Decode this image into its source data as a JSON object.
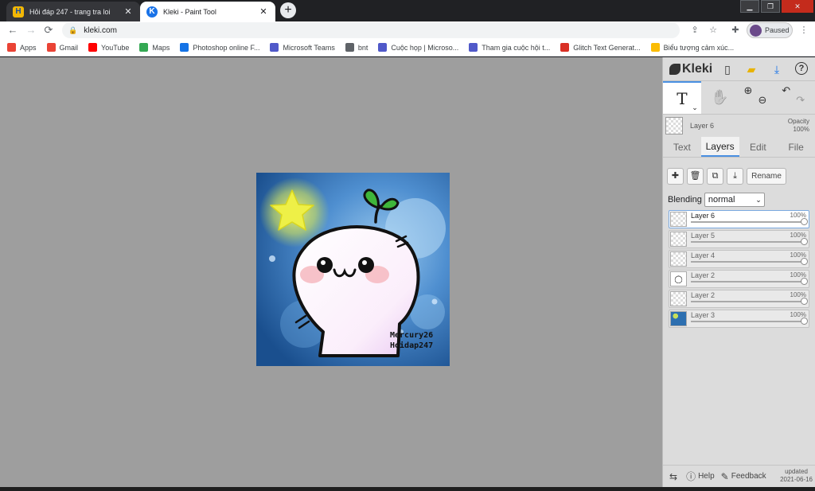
{
  "browser": {
    "tabs": [
      {
        "title": "Hỏi đáp 247 - trang tra loi",
        "favicon": "H",
        "favicon_color": "#f2b705"
      },
      {
        "title": "Kleki - Paint Tool",
        "favicon": "K",
        "favicon_color": "#1a73e8"
      }
    ],
    "address": "kleki.com",
    "profile_status": "Paused",
    "bookmarks": [
      {
        "label": "Apps",
        "icon": "apps-grid-icon",
        "color": "#ea4335"
      },
      {
        "label": "Gmail",
        "icon": "gmail-icon",
        "color": "#ea4335"
      },
      {
        "label": "YouTube",
        "icon": "youtube-icon",
        "color": "#ff0000"
      },
      {
        "label": "Maps",
        "icon": "maps-icon",
        "color": "#34a853"
      },
      {
        "label": "Photoshop online F...",
        "icon": "photoshop-icon",
        "color": "#1473e6"
      },
      {
        "label": "Microsoft Teams",
        "icon": "teams-icon",
        "color": "#5059c9"
      },
      {
        "label": "bnt",
        "icon": "globe-icon",
        "color": "#5f6368"
      },
      {
        "label": "Cuộc họp | Microso...",
        "icon": "teams-icon",
        "color": "#5059c9"
      },
      {
        "label": "Tham gia cuộc hội t...",
        "icon": "teams-icon",
        "color": "#5059c9"
      },
      {
        "label": "Glitch Text Generat...",
        "icon": "glitch-icon",
        "color": "#d93025"
      },
      {
        "label": "Biểu tượng cảm xúc...",
        "icon": "emoji-icon",
        "color": "#fbbc04"
      }
    ]
  },
  "app": {
    "name": "Kleki",
    "tools": {
      "text": "T",
      "hand": "✋"
    },
    "current_layer": {
      "name": "Layer 6",
      "opacity_label": "Opacity",
      "opacity_value": "100%"
    },
    "panel_tabs": [
      "Text",
      "Layers",
      "Edit",
      "File"
    ],
    "selected_tab": "Layers",
    "layer_buttons": {
      "rename": "Rename"
    },
    "blending": {
      "label": "Blending",
      "value": "normal"
    },
    "layers": [
      {
        "name": "Layer 6",
        "opacity": "100%",
        "level": 1.0,
        "active": true,
        "thumb": "empty"
      },
      {
        "name": "Layer 5",
        "opacity": "100%",
        "level": 1.0,
        "active": false,
        "thumb": "empty"
      },
      {
        "name": "Layer 4",
        "opacity": "100%",
        "level": 1.0,
        "active": false,
        "thumb": "empty"
      },
      {
        "name": "Layer 2",
        "opacity": "100%",
        "level": 1.0,
        "active": false,
        "thumb": "face"
      },
      {
        "name": "Layer 2",
        "opacity": "100%",
        "level": 1.0,
        "active": false,
        "thumb": "empty"
      },
      {
        "name": "Layer 3",
        "opacity": "100%",
        "level": 1.0,
        "active": false,
        "thumb": "bg"
      }
    ],
    "footer": {
      "help": "Help",
      "feedback": "Feedback",
      "updated_label": "updated",
      "updated_date": "2021-06-16"
    }
  },
  "artwork": {
    "watermark_line1": "Mercury26",
    "watermark_line2": "Hoidap247",
    "colors": {
      "sky_dark": "#1f5a9c",
      "sky_light": "#8ec3ec",
      "star": "#e8ec3a",
      "sprout": "#3fb63a",
      "blush": "#f6b8c0"
    }
  }
}
